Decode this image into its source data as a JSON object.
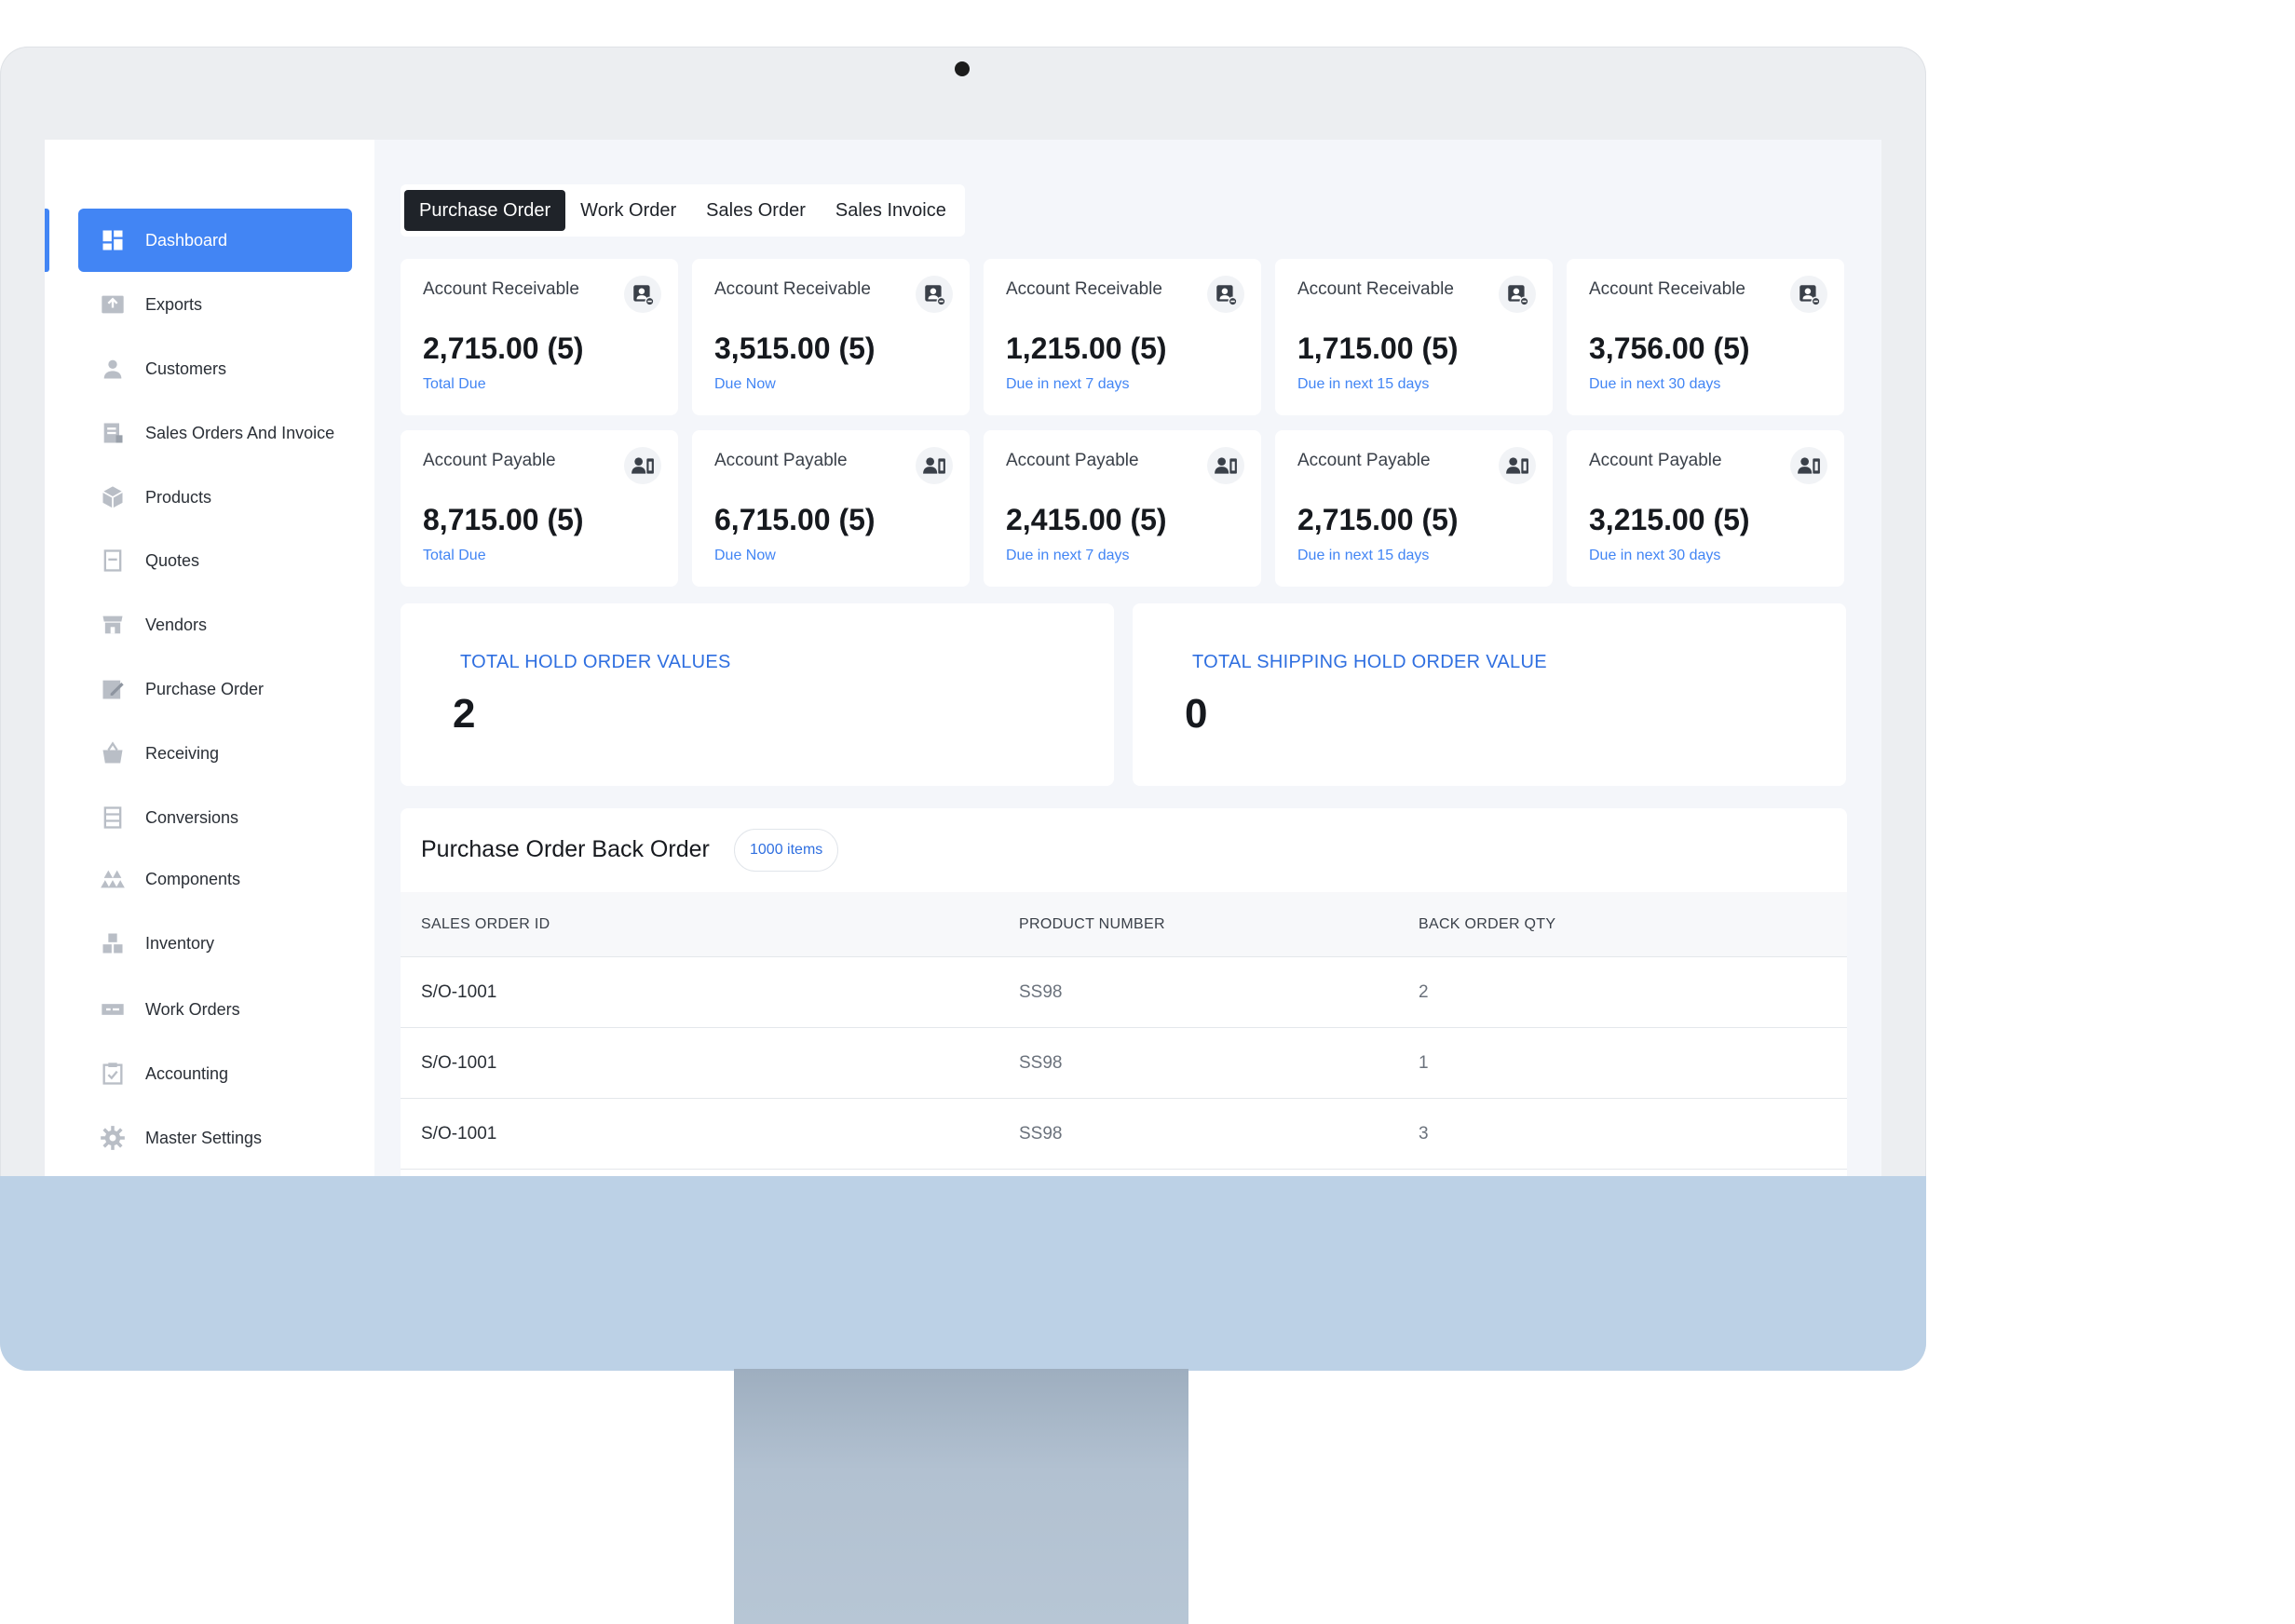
{
  "sidebar": {
    "items": [
      {
        "label": "Dashboard",
        "icon": "dashboard-icon"
      },
      {
        "label": "Exports",
        "icon": "exports-icon"
      },
      {
        "label": "Customers",
        "icon": "customers-icon"
      },
      {
        "label": "Sales Orders And Invoice",
        "icon": "invoice-icon"
      },
      {
        "label": "Products",
        "icon": "products-icon"
      },
      {
        "label": "Quotes",
        "icon": "quotes-icon"
      },
      {
        "label": "Vendors",
        "icon": "vendors-icon"
      },
      {
        "label": "Purchase Order",
        "icon": "purchase-order-icon"
      },
      {
        "label": "Receiving",
        "icon": "receiving-icon"
      },
      {
        "label": "Conversions",
        "icon": "conversions-icon"
      },
      {
        "label": "Components",
        "icon": "components-icon"
      },
      {
        "label": "Inventory",
        "icon": "inventory-icon"
      },
      {
        "label": "Work Orders",
        "icon": "work-orders-icon"
      },
      {
        "label": "Accounting",
        "icon": "accounting-icon"
      },
      {
        "label": "Master Settings",
        "icon": "settings-icon"
      }
    ]
  },
  "tabs": [
    "Purchase Order",
    "Work Order",
    "Sales Order",
    "Sales Invoice"
  ],
  "receivable_cards": [
    {
      "title": "Account Receivable",
      "value": "2,715.00 (5)",
      "sub": "Total Due"
    },
    {
      "title": "Account Receivable",
      "value": "3,515.00 (5)",
      "sub": "Due Now"
    },
    {
      "title": "Account Receivable",
      "value": "1,215.00 (5)",
      "sub": "Due in next 7 days"
    },
    {
      "title": "Account Receivable",
      "value": "1,715.00 (5)",
      "sub": "Due in next 15 days"
    },
    {
      "title": "Account Receivable",
      "value": "3,756.00 (5)",
      "sub": "Due in next 30 days"
    }
  ],
  "payable_cards": [
    {
      "title": "Account Payable",
      "value": "8,715.00 (5)",
      "sub": "Total Due"
    },
    {
      "title": "Account Payable",
      "value": "6,715.00 (5)",
      "sub": "Due Now"
    },
    {
      "title": "Account Payable",
      "value": "2,415.00 (5)",
      "sub": "Due in next 7 days"
    },
    {
      "title": "Account Payable",
      "value": "2,715.00 (5)",
      "sub": "Due in next 15 days"
    },
    {
      "title": "Account Payable",
      "value": "3,215.00 (5)",
      "sub": "Due in next 30 days"
    }
  ],
  "hold": [
    {
      "label": "TOTAL HOLD ORDER VALUES",
      "value": "2"
    },
    {
      "label": "TOTAL SHIPPING HOLD ORDER VALUE",
      "value": "0"
    }
  ],
  "back_order": {
    "title": "Purchase Order Back Order",
    "badge": "1000 items",
    "columns": [
      "SALES ORDER ID",
      "PRODUCT NUMBER",
      "BACK ORDER QTY"
    ],
    "rows": [
      [
        "S/O-1001",
        "SS98",
        "2"
      ],
      [
        "S/O-1001",
        "SS98",
        "1"
      ],
      [
        "S/O-1001",
        "SS98",
        "3"
      ]
    ]
  },
  "colors": {
    "accent": "#4285f4",
    "chin": "#bcd1e6",
    "label_blue": "#2f6fe0"
  }
}
